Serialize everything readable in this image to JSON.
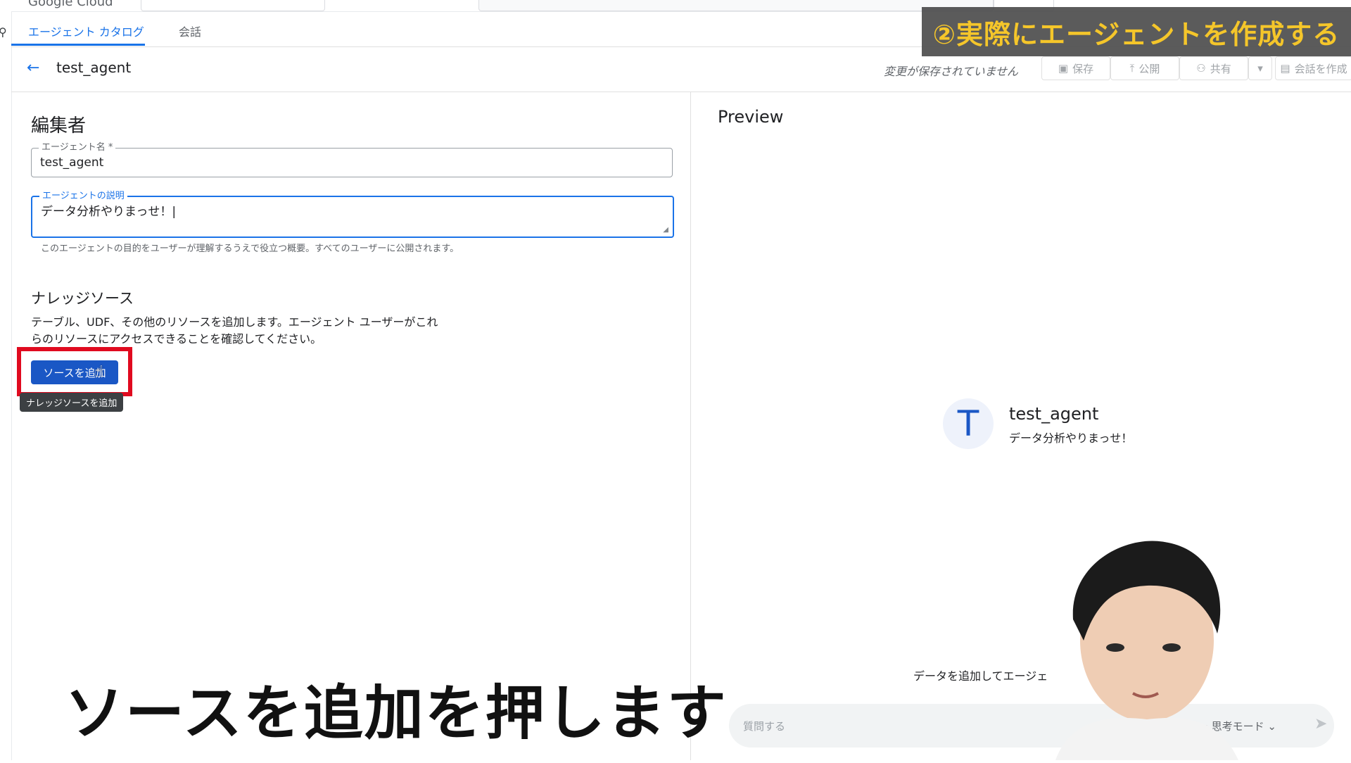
{
  "topbar": {
    "logo_text": "Google Cloud"
  },
  "tabs": [
    {
      "label": "エージェント カタログ",
      "active": true
    },
    {
      "label": "会話",
      "active": false
    }
  ],
  "header": {
    "title": "test_agent",
    "unsaved_text": "変更が保存されていません",
    "buttons": {
      "save": "保存",
      "publish": "公開",
      "share": "共有",
      "create_chat": "会話を作成"
    }
  },
  "banner": {
    "text": "②実際にエージェントを作成する"
  },
  "editor": {
    "title": "編集者",
    "name_field": {
      "label": "エージェント名 *",
      "value": "test_agent"
    },
    "desc_field": {
      "label": "エージェントの説明",
      "value": "データ分析やりまっせ！|"
    },
    "hint": "このエージェントの目的をユーザーが理解するうえで役立つ概要。すべてのユーザーに公開されます。",
    "knowledge": {
      "title": "ナレッジソース",
      "desc_line1": "テーブル、UDF、その他のリソースを追加します。エージェント ユーザーがこれ",
      "desc_line2": "らのリソースにアクセスできることを確認してください。",
      "add_button": "ソースを追加",
      "tooltip": "ナレッジソースを追加"
    }
  },
  "preview": {
    "title": "Preview",
    "avatar_letter": "T",
    "agent_name": "test_agent",
    "agent_desc": "データ分析やりまっせ！",
    "add_data_text": "データを追加してエージェ",
    "input_placeholder": "質問する",
    "mode_text": "sh · 思考モード ⌄"
  },
  "subtitle": "ソースを追加を押します",
  "colors": {
    "accent": "#1a73e8",
    "button": "#1a57c5",
    "highlight": "#e00a1f",
    "banner_text": "#f5c21a"
  }
}
